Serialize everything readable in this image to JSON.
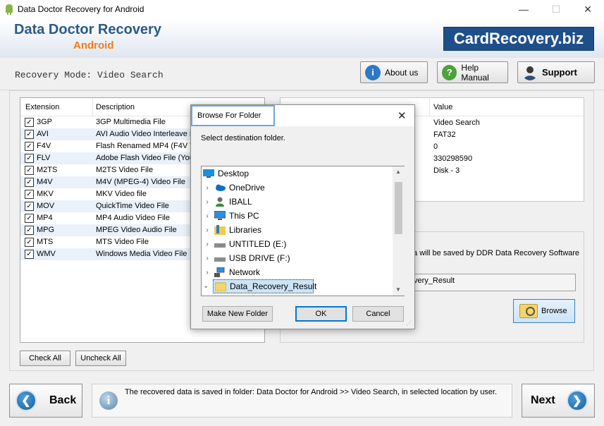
{
  "window": {
    "title": "Data Doctor Recovery for Android",
    "minimize": "—",
    "maximize": "☐",
    "close": "✕"
  },
  "brand": {
    "main": "Data Doctor Recovery",
    "sub": "Android",
    "site": "CardRecovery.biz"
  },
  "mode_text": "Recovery Mode: Video Search",
  "top_buttons": {
    "about": "About us",
    "help": "Help Manual",
    "support": "Support"
  },
  "ext_list": {
    "headers": {
      "extension": "Extension",
      "description": "Description"
    },
    "rows": [
      {
        "ext": "3GP",
        "desc": "3GP Multimedia File"
      },
      {
        "ext": "AVI",
        "desc": "AVI Audio Video Interleave F"
      },
      {
        "ext": "F4V",
        "desc": "Flash Renamed MP4 (F4V Vi"
      },
      {
        "ext": "FLV",
        "desc": "Adobe Flash Video File (You"
      },
      {
        "ext": "M2TS",
        "desc": "M2TS Video File"
      },
      {
        "ext": "M4V",
        "desc": "M4V (MPEG-4) Video File"
      },
      {
        "ext": "MKV",
        "desc": "MKV Video file"
      },
      {
        "ext": "MOV",
        "desc": "QuickTime Video File"
      },
      {
        "ext": "MP4",
        "desc": "MP4 Audio Video File"
      },
      {
        "ext": "MPG",
        "desc": "MPEG Video Audio File"
      },
      {
        "ext": "MTS",
        "desc": "MTS Video File"
      },
      {
        "ext": "WMV",
        "desc": "Windows Media Video File"
      }
    ]
  },
  "info": {
    "header": "Value",
    "values": [
      "Video Search",
      "FAT32",
      "0",
      "330298590",
      "Disk - 3"
    ]
  },
  "save": {
    "message": "ta will be saved by DDR Data Recovery Software",
    "path": "very_Result",
    "browse": "Browse"
  },
  "list_buttons": {
    "check_all": "Check All",
    "uncheck_all": "Uncheck All"
  },
  "footer": {
    "back": "Back",
    "next": "Next",
    "status": "The recovered data is saved in folder: Data Doctor for Android  >> Video Search, in selected location by user."
  },
  "dialog": {
    "title": "Browse For Folder",
    "prompt": "Select destination folder.",
    "tree": [
      {
        "label": "Desktop",
        "icon": "desktop-icon"
      },
      {
        "label": "OneDrive",
        "icon": "cloud-icon"
      },
      {
        "label": "IBALL",
        "icon": "user-icon"
      },
      {
        "label": "This PC",
        "icon": "computer-icon"
      },
      {
        "label": "Libraries",
        "icon": "library-icon"
      },
      {
        "label": "UNTITLED (E:)",
        "icon": "drive-icon"
      },
      {
        "label": "USB DRIVE (F:)",
        "icon": "drive-icon"
      },
      {
        "label": "Network",
        "icon": "network-icon"
      },
      {
        "label": "Data_Recovery_Result",
        "icon": "folder-icon"
      }
    ],
    "buttons": {
      "new_folder": "Make New Folder",
      "ok": "OK",
      "cancel": "Cancel"
    }
  }
}
